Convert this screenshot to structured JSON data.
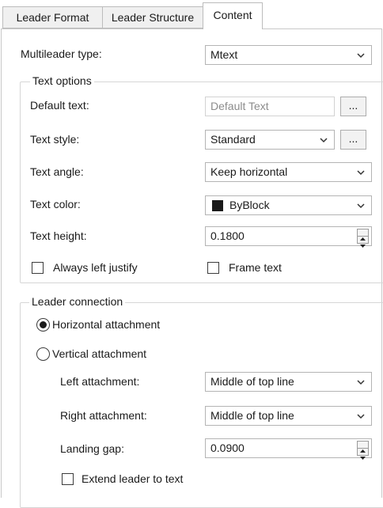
{
  "tabs": [
    {
      "label": "Leader Format",
      "active": false
    },
    {
      "label": "Leader Structure",
      "active": false
    },
    {
      "label": "Content",
      "active": true
    }
  ],
  "multileader_type": {
    "label": "Multileader type:",
    "value": "Mtext"
  },
  "text_options": {
    "legend": "Text options",
    "default_text": {
      "label": "Default text:",
      "value": "Default Text",
      "button": "..."
    },
    "text_style": {
      "label": "Text style:",
      "value": "Standard",
      "button": "..."
    },
    "text_angle": {
      "label": "Text angle:",
      "value": "Keep horizontal"
    },
    "text_color": {
      "label": "Text color:",
      "value": "ByBlock",
      "swatch": "#1a1a1a"
    },
    "text_height": {
      "label": "Text height:",
      "value": "0.1800"
    },
    "always_left_justify": {
      "label": "Always left justify",
      "checked": false
    },
    "frame_text": {
      "label": "Frame text",
      "checked": false
    }
  },
  "leader_connection": {
    "legend": "Leader connection",
    "horizontal_attachment": {
      "label": "Horizontal attachment",
      "selected": true
    },
    "vertical_attachment": {
      "label": "Vertical attachment",
      "selected": false
    },
    "left_attachment": {
      "label": "Left attachment:",
      "value": "Middle of top line"
    },
    "right_attachment": {
      "label": "Right attachment:",
      "value": "Middle of top line"
    },
    "landing_gap": {
      "label": "Landing gap:",
      "value": "0.0900"
    },
    "extend_leader": {
      "label": "Extend leader to text",
      "checked": false
    }
  }
}
